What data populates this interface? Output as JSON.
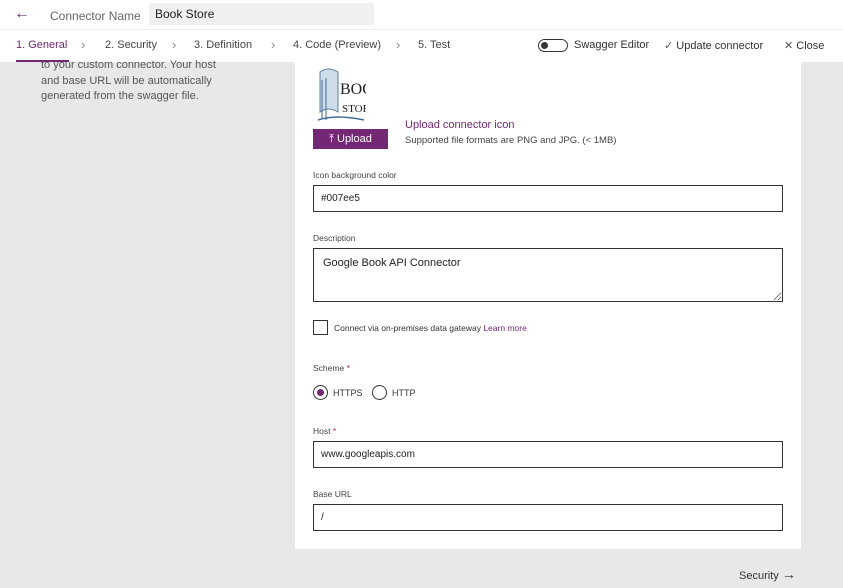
{
  "header": {
    "back_icon": "arrow-left-icon",
    "connector_name_label": "Connector Name",
    "connector_name_value": "Book Store"
  },
  "nav": {
    "steps": [
      {
        "label": "1. General",
        "active": true
      },
      {
        "label": "2. Security"
      },
      {
        "label": "3. Definition"
      },
      {
        "label": "4. Code (Preview)"
      },
      {
        "label": "5. Test"
      }
    ],
    "swagger_toggle_label": "Swagger Editor",
    "swagger_toggle_on": false,
    "update_label": "Update connector",
    "close_label": "Close"
  },
  "left_description": {
    "lines": [
      "to your custom connector. Your host",
      "and base URL will be automatically",
      "generated from the swagger file."
    ]
  },
  "icon_section": {
    "logo_text_top": "BOOK",
    "logo_text_bottom": "STORE",
    "upload_button_label": "Upload",
    "upload_link": "Upload connector icon",
    "upload_hint": "Supported file formats are PNG and JPG. (< 1MB)"
  },
  "form": {
    "icon_bg_label": "Icon background color",
    "icon_bg_value": "#007ee5",
    "description_label": "Description",
    "description_value": "Google Book API Connector",
    "gateway_checkbox_label": "Connect via on-premises data gateway",
    "gateway_checkbox_checked": false,
    "gateway_learn_more": "Learn more",
    "scheme_label": "Scheme",
    "required_mark": "*",
    "scheme_options": [
      "HTTPS",
      "HTTP"
    ],
    "scheme_selected": "HTTPS",
    "host_label": "Host",
    "host_value": "www.googleapis.com",
    "base_url_label": "Base URL",
    "base_url_value": "/"
  },
  "footer": {
    "next_label": "Security"
  },
  "colors": {
    "accent": "#742774",
    "background": "#e8e8e8",
    "panel": "#ffffff"
  }
}
